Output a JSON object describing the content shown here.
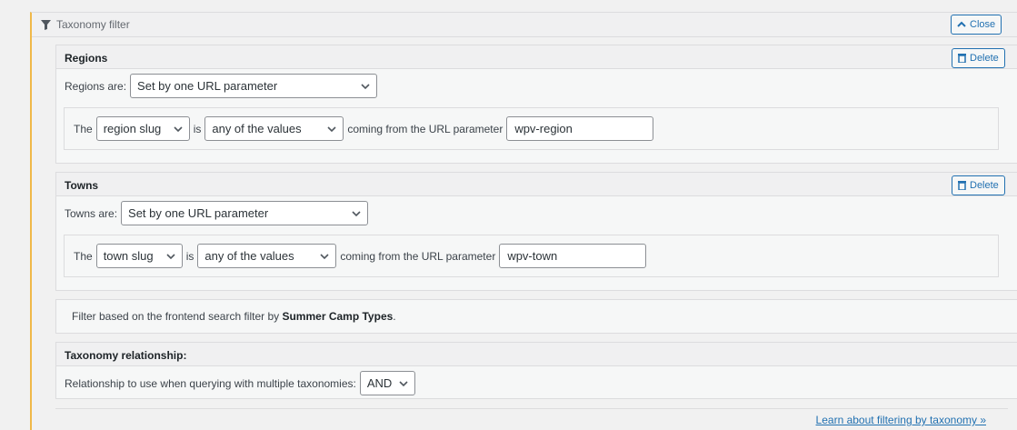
{
  "panel": {
    "title": "Taxonomy filter",
    "close_label": "Close"
  },
  "regions": {
    "title": "Regions",
    "delete_label": "Delete",
    "are_label": "Regions are:",
    "mode_value": "Set by one URL parameter",
    "the_label": "The",
    "field_value": "region slug",
    "is_label": "is",
    "op_value": "any of the values",
    "coming_label": "coming from the URL parameter",
    "param_value": "wpv-region"
  },
  "towns": {
    "title": "Towns",
    "delete_label": "Delete",
    "are_label": "Towns are:",
    "mode_value": "Set by one URL parameter",
    "the_label": "The",
    "field_value": "town slug",
    "is_label": "is",
    "op_value": "any of the values",
    "coming_label": "coming from the URL parameter",
    "param_value": "wpv-town"
  },
  "frontend_note": {
    "prefix": "Filter based on the frontend search filter by ",
    "bold": "Summer Camp Types",
    "suffix": "."
  },
  "relationship": {
    "title": "Taxonomy relationship:",
    "label": "Relationship to use when querying with multiple taxonomies:",
    "value": "AND"
  },
  "learn_link": "Learn about filtering by taxonomy »",
  "icons": [
    "funnel-icon",
    "chevron-up-icon",
    "trash-icon",
    "chevron-down-icon"
  ],
  "colors": {
    "accent": "#2271b1",
    "highlight_border": "#f0b849"
  }
}
